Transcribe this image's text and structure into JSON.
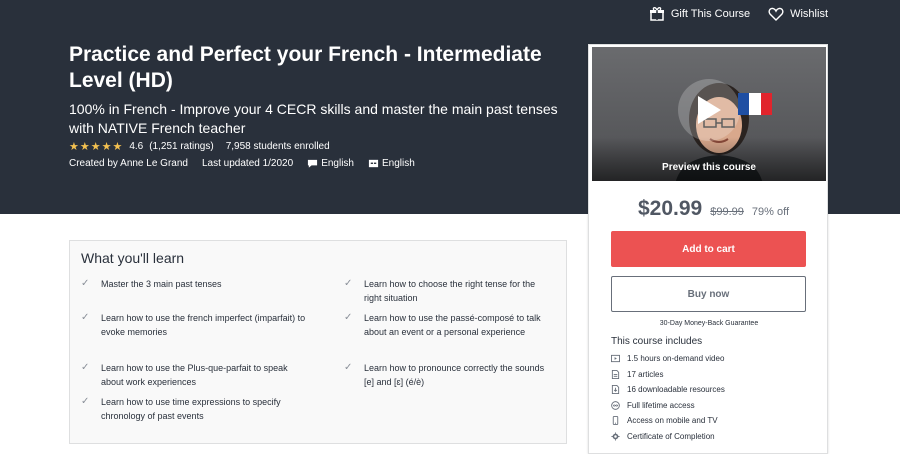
{
  "topbar": {
    "gift_label": "Gift This Course",
    "wishlist_label": "Wishlist"
  },
  "course": {
    "title": "Practice and Perfect your French - Intermediate Level (HD)",
    "subtitle": "100% in French - Improve your 4 CECR skills and master the main past tenses with NATIVE French teacher",
    "stars": "★★★★★",
    "rating": "4.6",
    "ratings_count": "(1,251 ratings)",
    "enrolled": "7,958 students enrolled",
    "created_by": "Created by Anne Le Grand",
    "last_updated": "Last updated 1/2020",
    "language": "English",
    "captions": "English"
  },
  "sidebar": {
    "preview_label": "Preview this course",
    "price": "$20.99",
    "original_price": "$99.99",
    "discount": "79% off",
    "add_to_cart": "Add to cart",
    "buy_now": "Buy now",
    "guarantee": "30-Day Money-Back Guarantee",
    "includes_title": "This course includes",
    "includes": [
      {
        "icon": "video-icon",
        "text": "1.5 hours on-demand video"
      },
      {
        "icon": "article-icon",
        "text": "17 articles"
      },
      {
        "icon": "download-icon",
        "text": "16 downloadable resources"
      },
      {
        "icon": "infinity-icon",
        "text": "Full lifetime access"
      },
      {
        "icon": "mobile-icon",
        "text": "Access on mobile and TV"
      },
      {
        "icon": "certificate-icon",
        "text": "Certificate of Completion"
      }
    ]
  },
  "learn": {
    "title": "What you'll learn",
    "check_glyph": "✓",
    "items": [
      "Master the 3 main past tenses",
      "Learn how to choose the right tense for the right situation",
      "Learn how to use the french imperfect (imparfait) to evoke memories",
      "Learn how to use the passé-composé to talk about an event or a personal experience",
      "Learn how to use the Plus-que-parfait to speak about work experiences",
      "Learn how to pronounce correctly the sounds [e] and [ɛ] (é/è)",
      "Learn how to use time expressions to specify chronology of past events"
    ]
  },
  "colors": {
    "hero_bg": "#29303b",
    "cart_button": "#ec5252",
    "stars": "#f4c150",
    "flag_blue": "#1f4fa3",
    "flag_white": "#ffffff",
    "flag_red": "#e1242c"
  }
}
